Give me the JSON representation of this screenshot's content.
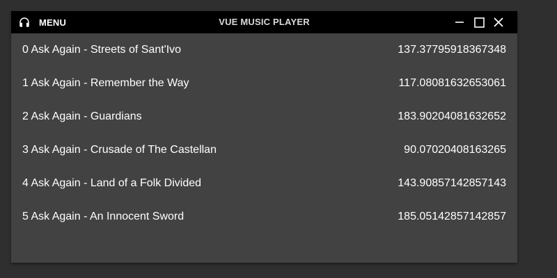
{
  "titlebar": {
    "menu_icon": "headphones-icon",
    "menu_label": "MENU",
    "title": "VUE MUSIC PLAYER",
    "controls": {
      "minimize_icon": "minimize-icon",
      "maximize_icon": "maximize-icon",
      "close_icon": "close-icon"
    }
  },
  "tracks": [
    {
      "title": "0 Ask Again - Streets of Sant'Ivo",
      "duration": "137.37795918367348"
    },
    {
      "title": "1 Ask Again - Remember the Way",
      "duration": "117.08081632653061"
    },
    {
      "title": "2 Ask Again - Guardians",
      "duration": "183.90204081632652"
    },
    {
      "title": "3 Ask Again - Crusade of The Castellan",
      "duration": "90.07020408163265"
    },
    {
      "title": "4 Ask Again - Land of a Folk Divided",
      "duration": "143.90857142857143"
    },
    {
      "title": "5 Ask Again - An Innocent Sword",
      "duration": "185.05142857142857"
    }
  ],
  "colors": {
    "titlebar_bg": "#000000",
    "window_bg": "#424242",
    "page_bg": "#2f2f2f",
    "text": "#ffffff"
  }
}
